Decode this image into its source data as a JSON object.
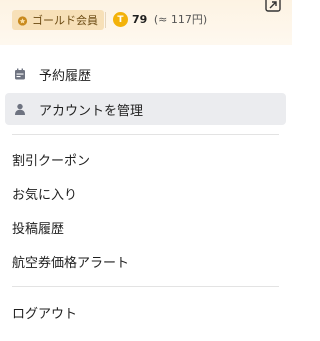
{
  "header": {
    "member_badge": "ゴールド会員",
    "points_value": "79",
    "points_approx": "(≈ 117円)",
    "coin_letter": "T",
    "exit_icon": "external-link-icon"
  },
  "menu": {
    "account_section": [
      {
        "label": "予約履歴",
        "icon": "calendar-icon"
      },
      {
        "label": "アカウントを管理",
        "icon": "user-icon"
      }
    ],
    "main_section": [
      {
        "label": "割引クーポン"
      },
      {
        "label": "お気に入り"
      },
      {
        "label": "投稿履歴"
      },
      {
        "label": "航空券価格アラート"
      }
    ],
    "logout_label": "ログアウト"
  },
  "colors": {
    "header_bg": "#fdf3e3",
    "badge_bg": "#f7e0b8",
    "coin": "#f3b20a",
    "active_row": "#ebecef",
    "icon": "#6e7380"
  }
}
